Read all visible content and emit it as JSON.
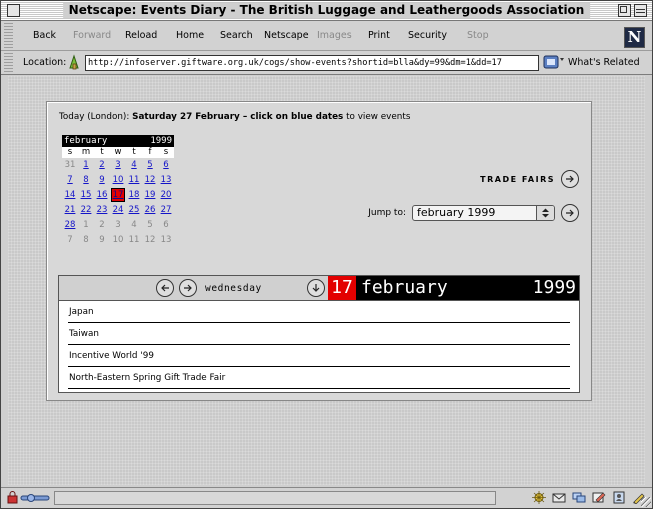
{
  "window": {
    "title": "Netscape: Events Diary - The British Luggage and Leathergoods Association"
  },
  "toolbar": {
    "buttons": [
      {
        "label": "Back",
        "enabled": true
      },
      {
        "label": "Forward",
        "enabled": false
      },
      {
        "label": "Reload",
        "enabled": true
      },
      {
        "label": "Home",
        "enabled": true
      },
      {
        "label": "Search",
        "enabled": true
      },
      {
        "label": "Netscape",
        "enabled": true
      },
      {
        "label": "Images",
        "enabled": false
      },
      {
        "label": "Print",
        "enabled": true
      },
      {
        "label": "Security",
        "enabled": true
      },
      {
        "label": "Stop",
        "enabled": false
      }
    ],
    "logo_letter": "N"
  },
  "location": {
    "label": "Location:",
    "url": "http://infoserver.giftware.org.uk/cogs/show-events?shortid=blla&dy=99&dm=1&dd=17",
    "related_label": "What's Related"
  },
  "page": {
    "today_prefix": "Today (London):",
    "today_bold": "Saturday 27 February – click on blue dates",
    "today_suffix": "to view events",
    "minical": {
      "month": "february",
      "year": "1999",
      "weekdays": [
        "s",
        "m",
        "t",
        "w",
        "t",
        "f",
        "s"
      ],
      "cells": [
        {
          "d": "31",
          "link": false
        },
        {
          "d": "1",
          "link": true
        },
        {
          "d": "2",
          "link": true
        },
        {
          "d": "3",
          "link": true
        },
        {
          "d": "4",
          "link": true
        },
        {
          "d": "5",
          "link": true
        },
        {
          "d": "6",
          "link": true
        },
        {
          "d": "7",
          "link": true
        },
        {
          "d": "8",
          "link": true
        },
        {
          "d": "9",
          "link": true
        },
        {
          "d": "10",
          "link": true
        },
        {
          "d": "11",
          "link": true
        },
        {
          "d": "12",
          "link": true
        },
        {
          "d": "13",
          "link": true
        },
        {
          "d": "14",
          "link": true
        },
        {
          "d": "15",
          "link": true
        },
        {
          "d": "16",
          "link": true
        },
        {
          "d": "17",
          "link": true,
          "selected": true
        },
        {
          "d": "18",
          "link": true
        },
        {
          "d": "19",
          "link": true
        },
        {
          "d": "20",
          "link": true
        },
        {
          "d": "21",
          "link": true
        },
        {
          "d": "22",
          "link": true
        },
        {
          "d": "23",
          "link": true
        },
        {
          "d": "24",
          "link": true
        },
        {
          "d": "25",
          "link": true
        },
        {
          "d": "26",
          "link": true
        },
        {
          "d": "27",
          "link": true
        },
        {
          "d": "28",
          "link": true
        },
        {
          "d": "1",
          "link": false
        },
        {
          "d": "2",
          "link": false
        },
        {
          "d": "3",
          "link": false
        },
        {
          "d": "4",
          "link": false
        },
        {
          "d": "5",
          "link": false
        },
        {
          "d": "6",
          "link": false
        },
        {
          "d": "7",
          "link": false
        },
        {
          "d": "8",
          "link": false
        },
        {
          "d": "9",
          "link": false
        },
        {
          "d": "10",
          "link": false
        },
        {
          "d": "11",
          "link": false
        },
        {
          "d": "12",
          "link": false
        },
        {
          "d": "13",
          "link": false
        }
      ],
      "link_color": "#1414c8",
      "selected_color": "#e30000"
    },
    "trade_fairs_label": "TRADE FAIRS",
    "jump_label": "Jump to:",
    "jump_value": "february 1999",
    "day_view": {
      "weekday": "wednesday",
      "day": "17",
      "month": "february",
      "year": "1999",
      "events": [
        "Japan",
        "Taiwan",
        "Incentive World '99",
        "North-Eastern Spring Gift Trade Fair"
      ]
    }
  }
}
